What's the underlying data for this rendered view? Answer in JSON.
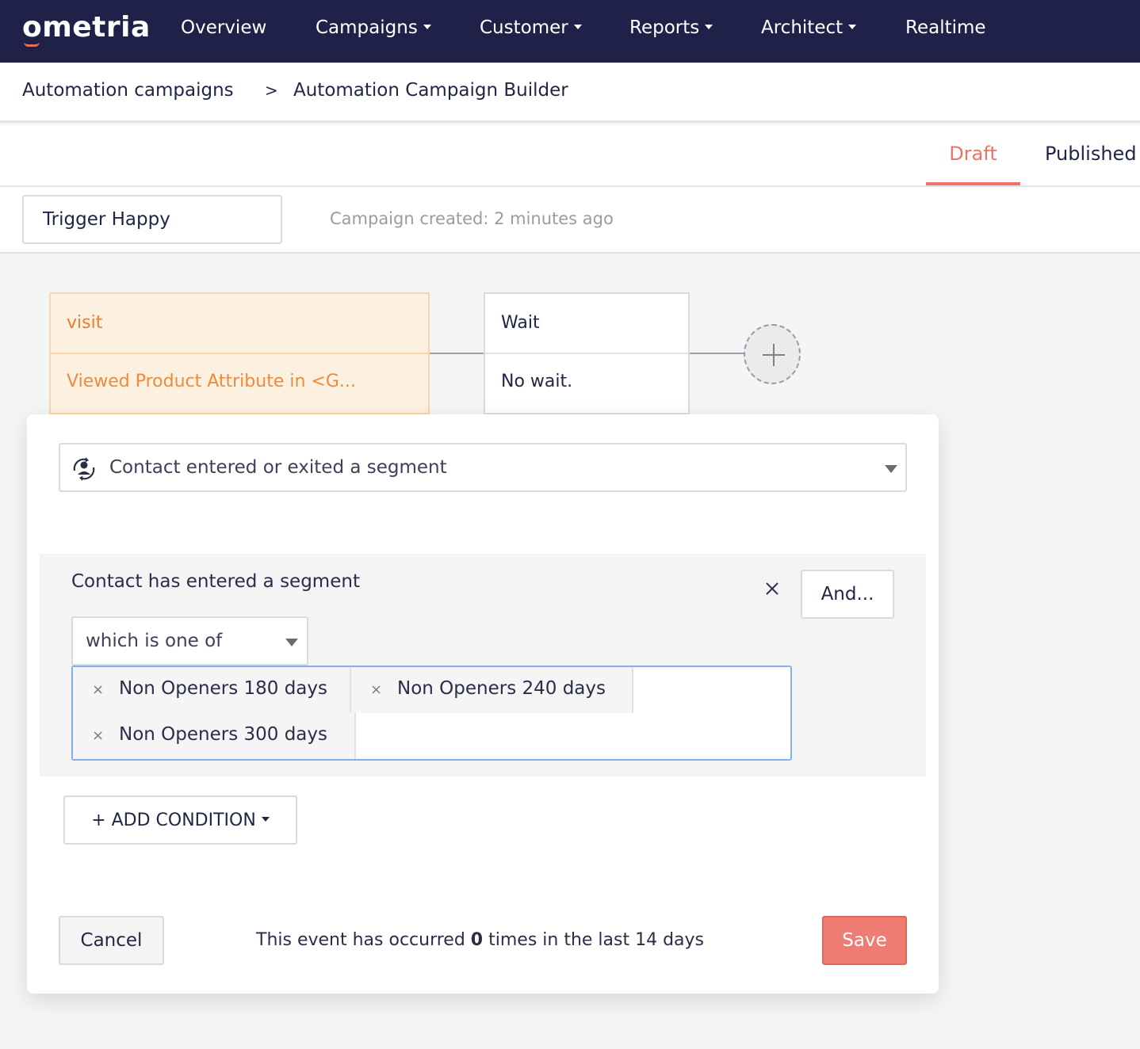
{
  "brand": {
    "logo": "ometria",
    "accent": "#ee7366",
    "nav_bg": "#1f2149"
  },
  "nav": {
    "overview": "Overview",
    "campaigns": "Campaigns",
    "customer": "Customer",
    "reports": "Reports",
    "architect": "Architect",
    "realtime": "Realtime"
  },
  "breadcrumb": {
    "parent": "Automation campaigns",
    "separator": ">",
    "current": "Automation Campaign Builder"
  },
  "tabs": {
    "draft": "Draft",
    "published": "Published",
    "active": "draft"
  },
  "campaign": {
    "name": "Trigger Happy",
    "created": "Campaign created: 2 minutes ago"
  },
  "flow": {
    "trigger": {
      "title": "visit",
      "detail": "Viewed Product Attribute in <G..."
    },
    "wait": {
      "title": "Wait",
      "detail": "No wait."
    },
    "add_icon": "plus-icon"
  },
  "editor": {
    "event_icon": "segment-cycle-icon",
    "event_type": "Contact entered or exited a segment",
    "condition": {
      "title": "Contact has entered a segment",
      "and_label": "And...",
      "operator": "which is one of",
      "tags": [
        {
          "remove": "×",
          "label": "Non Openers 180 days"
        },
        {
          "remove": "×",
          "label": "Non Openers 240 days"
        },
        {
          "remove": "×",
          "label": "Non Openers 300 days"
        }
      ]
    },
    "add_condition": "+ ADD CONDITION",
    "cancel": "Cancel",
    "occurrence": {
      "prefix": "This event has occurred",
      "count": "0",
      "suffix": "times in the last 14 days"
    },
    "save": "Save"
  }
}
